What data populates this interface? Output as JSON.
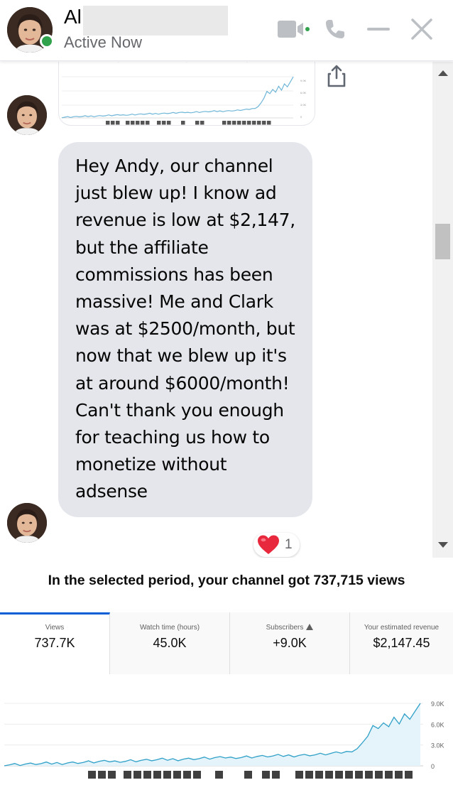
{
  "header": {
    "contact_name": "Al",
    "status": "Active Now",
    "icons": [
      "video-call-icon",
      "phone-icon",
      "minimize-icon",
      "close-icon"
    ],
    "online_color": "#31a24c"
  },
  "conversation": {
    "message_text": "Hey Andy, our channel just blew up! I know ad revenue is low at $2,147, but the affiliate commissions has been massive! Me and Clark was at $2500/month, but now that we blew up it's at around $6000/month! Can't thank you enough for teaching us how to monetize without adsense",
    "reaction": {
      "icon": "heart-icon",
      "count": "1"
    },
    "bubble_color": "#e4e6eb"
  },
  "analytics": {
    "summary": "In the selected period, your channel got 737,715 views",
    "metrics": [
      {
        "label": "Views",
        "value": "737.7K"
      },
      {
        "label": "Watch time (hours)",
        "value": "45.0K"
      },
      {
        "label": "Subscribers",
        "value": "+9.0K"
      },
      {
        "label": "Your estimated revenue",
        "value": "$2,147.45"
      }
    ],
    "accent_color": "#065fd4",
    "line_color": "#2fa0c8"
  },
  "chart_data": {
    "type": "line",
    "y_tick_labels": [
      "9.0K",
      "6.0K",
      "3.0K",
      "0"
    ],
    "ylim": [
      0,
      9000
    ],
    "grid": true,
    "legend": "none",
    "series": [
      {
        "values": [
          150,
          180,
          220,
          200,
          260,
          240,
          300,
          280,
          350,
          330,
          400,
          380,
          450,
          430,
          500,
          480,
          560,
          540,
          600,
          590,
          650,
          630,
          700,
          680,
          760,
          740,
          800,
          780,
          850,
          840,
          900,
          880,
          950,
          930,
          1000,
          980,
          1050,
          1030,
          1100,
          1080,
          1150,
          1130,
          1200,
          1180,
          1250,
          1230,
          1300,
          1280,
          1350,
          1330,
          1400,
          1380,
          1450,
          1430,
          1500,
          1480,
          1550,
          1530,
          1600,
          1580,
          1650,
          1700,
          1750,
          1800,
          1900,
          2000,
          2200,
          2500,
          3200,
          4400,
          5800,
          5200,
          6300,
          5600,
          6800,
          6100,
          7400,
          6900,
          7900,
          9000
        ]
      }
    ]
  }
}
